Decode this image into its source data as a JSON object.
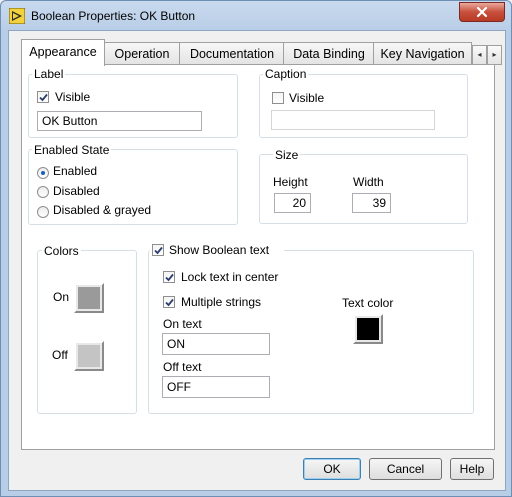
{
  "window": {
    "title": "Boolean Properties: OK Button",
    "close_glyph": "✕"
  },
  "tabs": [
    {
      "label": "Appearance",
      "active": true
    },
    {
      "label": "Operation",
      "active": false
    },
    {
      "label": "Documentation",
      "active": false
    },
    {
      "label": "Data Binding",
      "active": false
    },
    {
      "label": "Key Navigation",
      "active": false
    }
  ],
  "tab_scroll": {
    "left": "◂",
    "right": "▸"
  },
  "label_group": {
    "title": "Label",
    "visible_label": "Visible",
    "visible_checked": true,
    "value": "OK Button"
  },
  "caption_group": {
    "title": "Caption",
    "visible_label": "Visible",
    "visible_checked": false,
    "value": ""
  },
  "enabled_state": {
    "title": "Enabled State",
    "options": [
      "Enabled",
      "Disabled",
      "Disabled & grayed"
    ],
    "selected": "Enabled"
  },
  "size": {
    "title": "Size",
    "height_label": "Height",
    "height_value": "20",
    "width_label": "Width",
    "width_value": "39"
  },
  "colors": {
    "title": "Colors",
    "on_label": "On",
    "off_label": "Off",
    "on_color": "#9a9a9a",
    "off_color": "#c4c4c4"
  },
  "boolean_text": {
    "show_label": "Show Boolean text",
    "show_checked": true,
    "lock_label": "Lock text in center",
    "lock_checked": true,
    "multiple_label": "Multiple strings",
    "multiple_checked": true,
    "on_text_label": "On text",
    "on_text_value": "ON",
    "off_text_label": "Off text",
    "off_text_value": "OFF",
    "text_color_label": "Text color",
    "text_color": "#000000"
  },
  "buttons": {
    "ok": "OK",
    "cancel": "Cancel",
    "help": "Help"
  }
}
